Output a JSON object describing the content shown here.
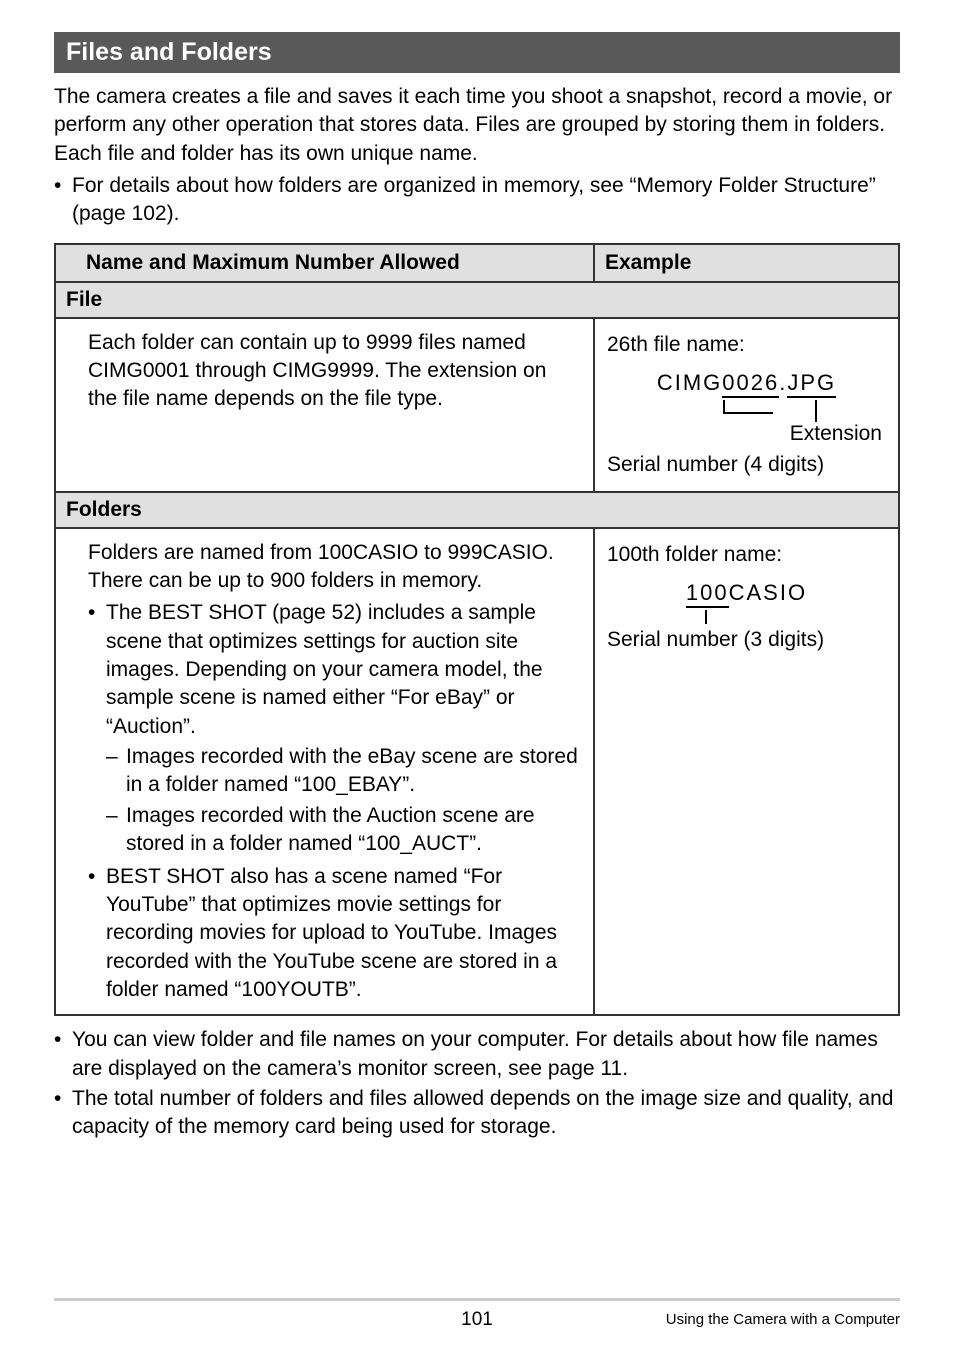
{
  "section_title": "Files and Folders",
  "intro_text": "The camera creates a file and saves it each time you shoot a snapshot, record a movie, or perform any other operation that stores data. Files are grouped by storing them in folders. Each file and folder has its own unique name.",
  "intro_bullet": "For details about how folders are organized in memory, see “Memory Folder Structure” (page 102).",
  "table": {
    "header_left": "Name and Maximum Number Allowed",
    "header_right": "Example",
    "file_label": "File",
    "file_desc": "Each folder can contain up to 9999 files named CIMG0001 through CIMG9999. The extension on the file name depends on the file type.",
    "file_example_title": "26th file name:",
    "file_example_name_prefix": "CIMG",
    "file_example_name_serial": "0026",
    "file_example_name_dot": ".",
    "file_example_name_ext": "JPG",
    "file_ext_label": "Extension",
    "file_serial_label": "Serial number (4 digits)",
    "folders_label": "Folders",
    "folders_desc_l1": "Folders are named from 100CASIO to 999CASIO.",
    "folders_desc_l2": "There can be up to 900 folders in memory.",
    "folders_bullet1": "The BEST SHOT (page 52) includes a sample scene that optimizes settings for auction site images. Depending on your camera model, the sample scene is named either “For eBay” or “Auction”.",
    "folders_sub1": "Images recorded with the eBay scene are stored in a folder named “100_EBAY”.",
    "folders_sub2": "Images recorded with the Auction scene are stored in a folder named “100_AUCT”.",
    "folders_bullet2": "BEST SHOT also has a scene named “For YouTube” that optimizes movie settings for recording movies for upload to YouTube. Images recorded with the YouTube scene are stored in a folder named “100YOUTB”.",
    "folder_example_title": "100th folder name:",
    "folder_example_serial": "100",
    "folder_example_suffix": "CASIO",
    "folder_serial_label": "Serial number (3 digits)"
  },
  "footer_bullet1": "You can view folder and file names on your computer. For details about how file names are displayed on the camera’s monitor screen, see page 11.",
  "footer_bullet2": "The total number of folders and files allowed depends on the image size and quality, and capacity of the memory card being used for storage.",
  "page_number": "101",
  "footer_caption": "Using the Camera with a Computer"
}
